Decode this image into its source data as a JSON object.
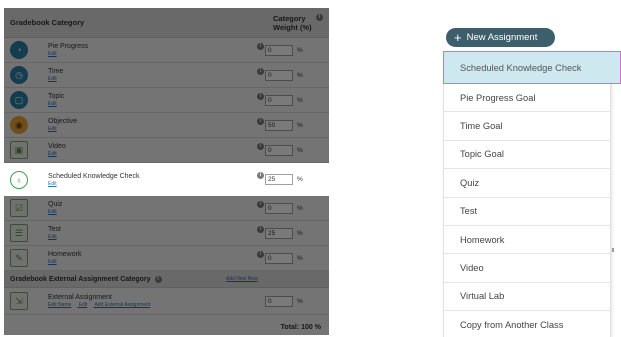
{
  "gradebook": {
    "header": {
      "category": "Gradebook Category",
      "weight": "Category Weight (%)",
      "info": "i"
    },
    "edit_label": "Edit",
    "percent_sign": "%",
    "rows": [
      {
        "name": "Pie Progress",
        "weight": "0",
        "icon": "pie-progress-icon"
      },
      {
        "name": "Time",
        "weight": "0",
        "icon": "clock-icon"
      },
      {
        "name": "Topic",
        "weight": "0",
        "icon": "topic-icon"
      },
      {
        "name": "Objective",
        "weight": "50",
        "icon": "objective-icon"
      },
      {
        "name": "Video",
        "weight": "0",
        "icon": "video-icon"
      },
      {
        "name": "Scheduled Knowledge Check",
        "weight": "25",
        "icon": "knowledge-check-icon"
      },
      {
        "name": "Quiz",
        "weight": "0",
        "icon": "quiz-icon"
      },
      {
        "name": "Test",
        "weight": "25",
        "icon": "test-icon"
      },
      {
        "name": "Homework",
        "weight": "0",
        "icon": "homework-icon"
      }
    ],
    "external_section": {
      "title": "Gradebook External Assignment Category",
      "add_link": "Add New Row",
      "row": {
        "name": "External Assignment",
        "links": [
          "Edit Name",
          "Edit",
          "Add External Assignment"
        ],
        "weight": "0"
      }
    },
    "total": "Total: 100 %"
  },
  "menu": {
    "new_button": "New Assignment",
    "items": [
      "Scheduled Knowledge Check",
      "Pie Progress Goal",
      "Time Goal",
      "Topic Goal",
      "Quiz",
      "Test",
      "Homework",
      "Video",
      "Virtual Lab",
      "Copy from Another Class"
    ],
    "selected_index": 0
  },
  "colors": {
    "accent": "#3d5e6b",
    "selection": "#cde8ef",
    "selection_border": "#d56ed0",
    "link": "#2b6fb8"
  }
}
